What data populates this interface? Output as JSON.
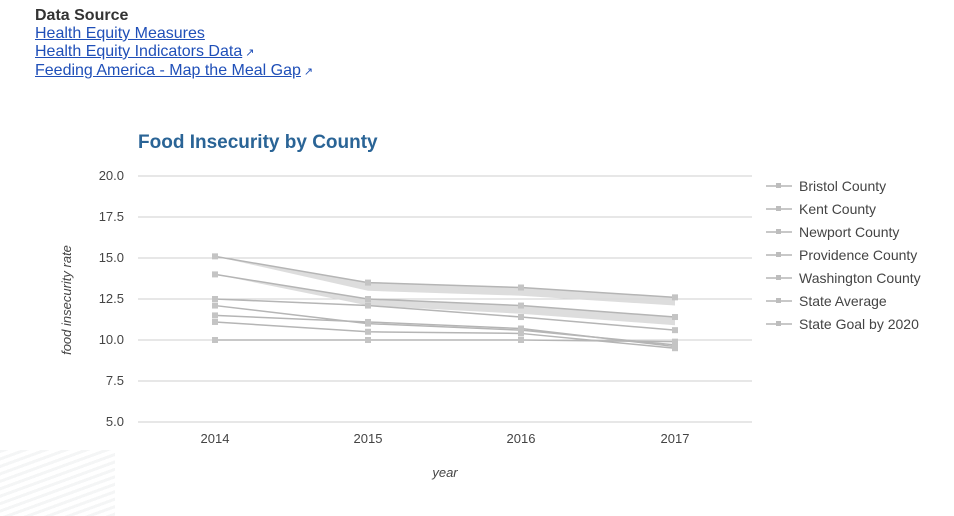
{
  "data_source": {
    "title": "Data Source",
    "links": [
      {
        "label": "Health Equity Measures",
        "external": false
      },
      {
        "label": "Health Equity Indicators Data",
        "external": true
      },
      {
        "label": "Feeding America - Map the Meal Gap",
        "external": true
      }
    ],
    "external_icon": "↗"
  },
  "chart_data": {
    "type": "line",
    "title": "Food Insecurity by County",
    "xlabel": "year",
    "ylabel": "food insecurity rate",
    "x": [
      "2014",
      "2015",
      "2016",
      "2017"
    ],
    "ylim": [
      5.0,
      20.0
    ],
    "yticks": [
      "5.0",
      "7.5",
      "10.0",
      "12.5",
      "15.0",
      "17.5",
      "20.0"
    ],
    "grid": true,
    "legend_position": "right",
    "line_color": "#b5b5b5",
    "band_color": "#d9d9d9",
    "series": [
      {
        "name": "Bristol County",
        "values": [
          11.1,
          10.5,
          10.4,
          9.5
        ]
      },
      {
        "name": "Kent County",
        "values": [
          12.1,
          11.0,
          10.6,
          9.7
        ]
      },
      {
        "name": "Newport County",
        "values": [
          14.0,
          12.5,
          12.1,
          11.4
        ]
      },
      {
        "name": "Providence County",
        "values": [
          15.1,
          13.5,
          13.2,
          12.6
        ]
      },
      {
        "name": "Washington County",
        "values": [
          11.5,
          11.1,
          10.7,
          9.6
        ]
      },
      {
        "name": "State Average",
        "values": [
          12.5,
          12.1,
          11.4,
          10.6
        ]
      },
      {
        "name": "State Goal by 2020",
        "values": [
          10.0,
          10.0,
          10.0,
          9.9
        ]
      }
    ]
  }
}
